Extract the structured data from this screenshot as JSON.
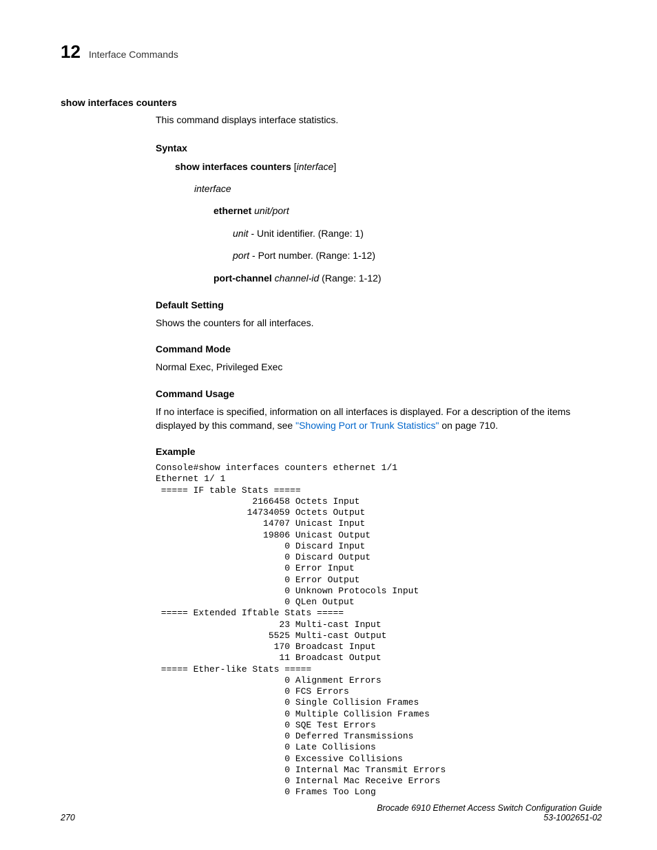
{
  "header": {
    "chapter_num": "12",
    "chapter_title": "Interface Commands"
  },
  "command": {
    "title": "show interfaces counters",
    "description": "This command displays interface statistics.",
    "syntax": {
      "heading": "Syntax",
      "line_cmd": "show interfaces counters",
      "line_arg": "interface",
      "interface_label": "interface",
      "ethernet_kw": "ethernet",
      "ethernet_args": "unit/port",
      "unit_label": "unit",
      "unit_desc": " - Unit identifier. (Range: 1)",
      "port_label": "port",
      "port_desc": " - Port number. (Range: 1-12)",
      "portchannel_kw": "port-channel",
      "portchannel_arg": "channel-id",
      "portchannel_desc": " (Range: 1-12)"
    },
    "default_setting": {
      "heading": "Default Setting",
      "text": "Shows the counters for all interfaces."
    },
    "command_mode": {
      "heading": "Command Mode",
      "text": "Normal Exec, Privileged Exec"
    },
    "command_usage": {
      "heading": "Command Usage",
      "text_pre": "If no interface is specified, information on all interfaces is displayed. For a description of the items displayed by this command, see ",
      "link_text": "\"Showing Port or Trunk Statistics\"",
      "text_post": " on page 710."
    },
    "example": {
      "heading": "Example",
      "output": "Console#show interfaces counters ethernet 1/1\nEthernet 1/ 1\n ===== IF table Stats =====\n                  2166458 Octets Input\n                 14734059 Octets Output\n                    14707 Unicast Input\n                    19806 Unicast Output\n                        0 Discard Input\n                        0 Discard Output\n                        0 Error Input\n                        0 Error Output\n                        0 Unknown Protocols Input\n                        0 QLen Output\n ===== Extended Iftable Stats =====\n                       23 Multi-cast Input\n                     5525 Multi-cast Output\n                      170 Broadcast Input\n                       11 Broadcast Output\n ===== Ether-like Stats =====\n                        0 Alignment Errors\n                        0 FCS Errors\n                        0 Single Collision Frames\n                        0 Multiple Collision Frames\n                        0 SQE Test Errors\n                        0 Deferred Transmissions\n                        0 Late Collisions\n                        0 Excessive Collisions\n                        0 Internal Mac Transmit Errors\n                        0 Internal Mac Receive Errors\n                        0 Frames Too Long"
    }
  },
  "footer": {
    "page_num": "270",
    "doc_title": "Brocade 6910 Ethernet Access Switch Configuration Guide",
    "doc_id": "53-1002651-02"
  }
}
